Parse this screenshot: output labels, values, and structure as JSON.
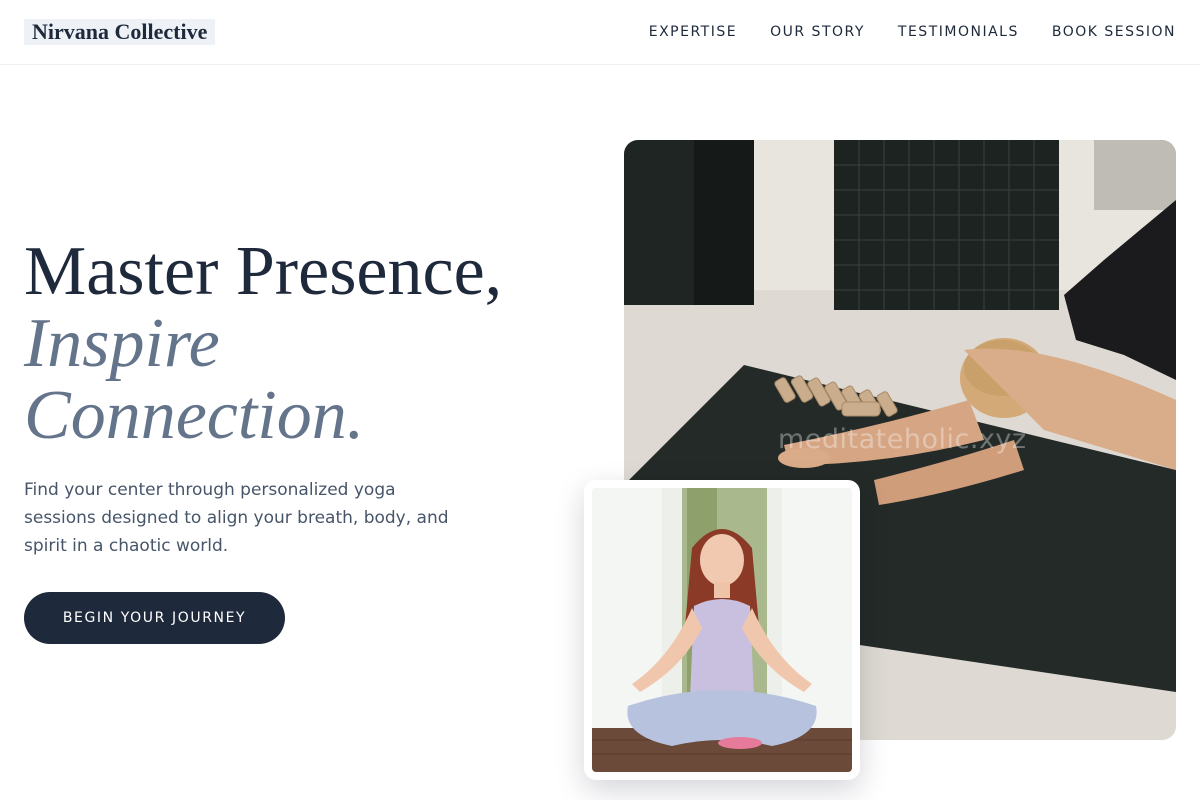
{
  "header": {
    "brand": "Nirvana Collective",
    "nav": [
      {
        "label": "EXPERTISE"
      },
      {
        "label": "OUR STORY"
      },
      {
        "label": "TESTIMONIALS"
      },
      {
        "label": "BOOK SESSION"
      }
    ]
  },
  "hero": {
    "title_line1": "Master Presence,",
    "title_line2": "Inspire",
    "title_line3": "Connection.",
    "description": "Find your center through personalized yoga sessions designed to align your breath, body, and spirit in a chaotic world.",
    "cta_label": "BEGIN YOUR JOURNEY"
  },
  "media": {
    "main_image_alt": "Woman stretching in child's pose on a dark yoga mat",
    "inset_image_alt": "Woman meditating in lotus pose outdoors",
    "watermark": "meditateholic.xyz"
  },
  "colors": {
    "primary": "#1e293b",
    "accent": "#64748b",
    "body_text": "#475569",
    "brand_highlight": "#eef2f7"
  }
}
